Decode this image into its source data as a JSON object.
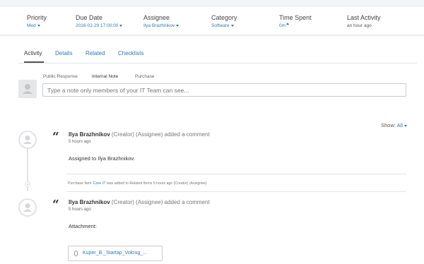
{
  "meta": [
    {
      "label": "Priority",
      "value": "Med",
      "kind": "dropdown"
    },
    {
      "label": "Due Date",
      "value": "2016-02-29 17:00:00",
      "kind": "dropdown"
    },
    {
      "label": "Assignee",
      "value": "Ilya Brazhnikov",
      "kind": "dropdown"
    },
    {
      "label": "Category",
      "value": "Software",
      "kind": "dropdown"
    },
    {
      "label": "Time Spent",
      "value": "0m",
      "kind": "toggle"
    },
    {
      "label": "Last Activity",
      "value": "an hour ago",
      "kind": "static"
    }
  ],
  "tabs": [
    {
      "label": "Activity",
      "active": true
    },
    {
      "label": "Details"
    },
    {
      "label": "Related"
    },
    {
      "label": "Checklists"
    }
  ],
  "response_tabs": [
    {
      "label": "Public Response"
    },
    {
      "label": "Internal Note",
      "active": true
    },
    {
      "label": "Purchase"
    }
  ],
  "note": {
    "placeholder": "Type a note only members of your IT Team can see..."
  },
  "show": {
    "label": "Show:",
    "value": "All"
  },
  "comments": [
    {
      "name": "Ilya Brazhnikov",
      "roles": "(Creator) (Assignee)",
      "action": "added a comment",
      "time": "5 hours ago",
      "body": "Assigned to Ilya Brazhnikov."
    },
    {
      "name": "Ilya Brazhnikov",
      "roles": "(Creator) (Assignee)",
      "action": "added a comment",
      "time": "5 hours ago",
      "body": "Attachment:",
      "attachment": "Kuper_B._Startap_Vokrug_..."
    }
  ],
  "log_entry": {
    "prefix": "Purchase Item ",
    "item": "'Core i7'",
    "suffix": " was added to Related Items 5 hours ago (Creator) (Assignee)"
  },
  "icons": {
    "quote": "quote-icon",
    "avatar": "user-avatar-icon",
    "attachment": "paperclip-icon",
    "dropdown": "caret-down-icon"
  },
  "colors": {
    "link": "#2a7ab9",
    "text": "#333333"
  }
}
